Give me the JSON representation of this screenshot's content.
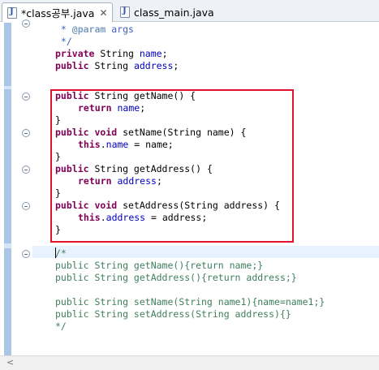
{
  "tabs": [
    {
      "label": "*class공부.java",
      "icon": "java-file-icon",
      "close": "✕"
    },
    {
      "label": "class_main.java",
      "icon": "java-file-icon"
    }
  ],
  "icon_letter": "J",
  "code": {
    "comment_param_prefix": " * ",
    "comment_param_tag": "@param",
    "comment_param_name": " args",
    "comment_close": " */",
    "private_kw": "private",
    "public_kw": "public",
    "type_string": " String ",
    "field_name": "name",
    "field_address": "address",
    "semicolon": ";",
    "getname_sig": " String getName() {",
    "return_kw": "return",
    "close_brace": "}",
    "void_kw": " void ",
    "setname_sig": "setName(String name) {",
    "this_kw": "this",
    "dot": ".",
    "assign_name": " = name;",
    "getaddress_sig": " String getAddress() {",
    "setaddress_sig": "setAddress(String address) {",
    "assign_address": " = address;",
    "block_comment": [
      "/*",
      "public String getName(){return name;}",
      "public String getAddress(){return address;}",
      "",
      "public String setName(String name1){name=name1;}",
      "public String setAddress(String address){}",
      "*/"
    ]
  },
  "colors": {
    "keyword": "#7f0055",
    "field": "#0000c0",
    "comment": "#3f7f5f",
    "javadoc": "#3f5fbf",
    "highlight_box": "#e0112b",
    "current_line": "#e8f2fe"
  },
  "scrollbar": {
    "left_arrow": "<"
  }
}
